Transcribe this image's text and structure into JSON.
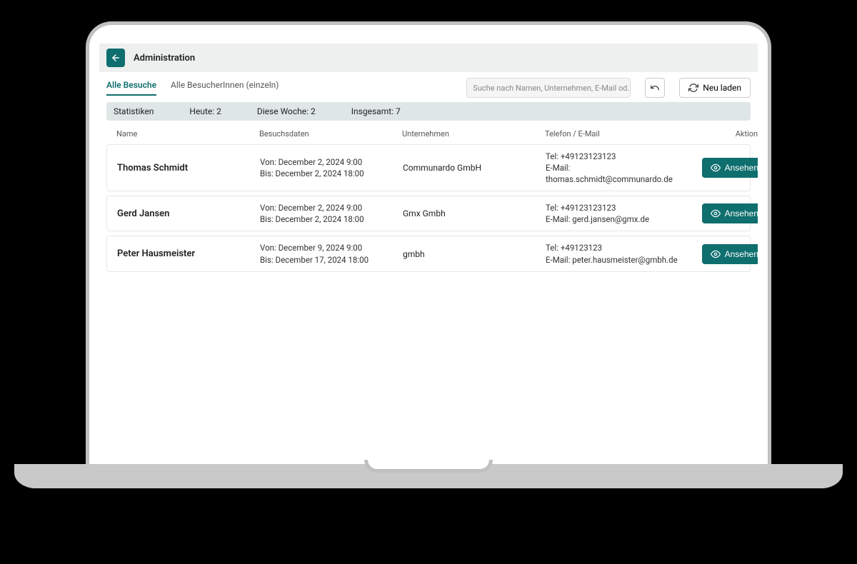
{
  "header": {
    "title": "Administration"
  },
  "tabs": {
    "all_visits": "Alle Besuche",
    "all_visitors": "Alle BesucherInnen (einzeln)"
  },
  "toolbar": {
    "search_placeholder": "Suche nach Namen, Unternehmen, E-Mail od...",
    "reload": "Neu laden"
  },
  "stats": {
    "label": "Statistiken",
    "today": "Heute: 2",
    "week": "Diese Woche: 2",
    "total": "Insgesamt: 7"
  },
  "columns": {
    "name": "Name",
    "visit": "Besuchsdaten",
    "company": "Unternehmen",
    "contact": "Telefon / E-Mail",
    "actions": "Aktionen"
  },
  "actions": {
    "view": "Ansehen"
  },
  "rows": [
    {
      "name": "Thomas Schmidt",
      "from": "Von: December 2, 2024 9:00",
      "to": "Bis: December 2, 2024 18:00",
      "company": "Communardo GmbH",
      "tel": "Tel: +49123123123",
      "email": "E-Mail: thomas.schmidt@communardo.de"
    },
    {
      "name": "Gerd Jansen",
      "from": "Von: December 2, 2024 9:00",
      "to": "Bis: December 2, 2024 18:00",
      "company": "Gmx Gmbh",
      "tel": "Tel: +49123123123",
      "email": "E-Mail: gerd.jansen@gmx.de"
    },
    {
      "name": "Peter Hausmeister",
      "from": "Von: December 9, 2024 9:00",
      "to": "Bis: December 17, 2024 18:00",
      "company": "gmbh",
      "tel": "Tel: +49123123",
      "email": "E-Mail: peter.hausmeister@gmbh.de"
    }
  ]
}
